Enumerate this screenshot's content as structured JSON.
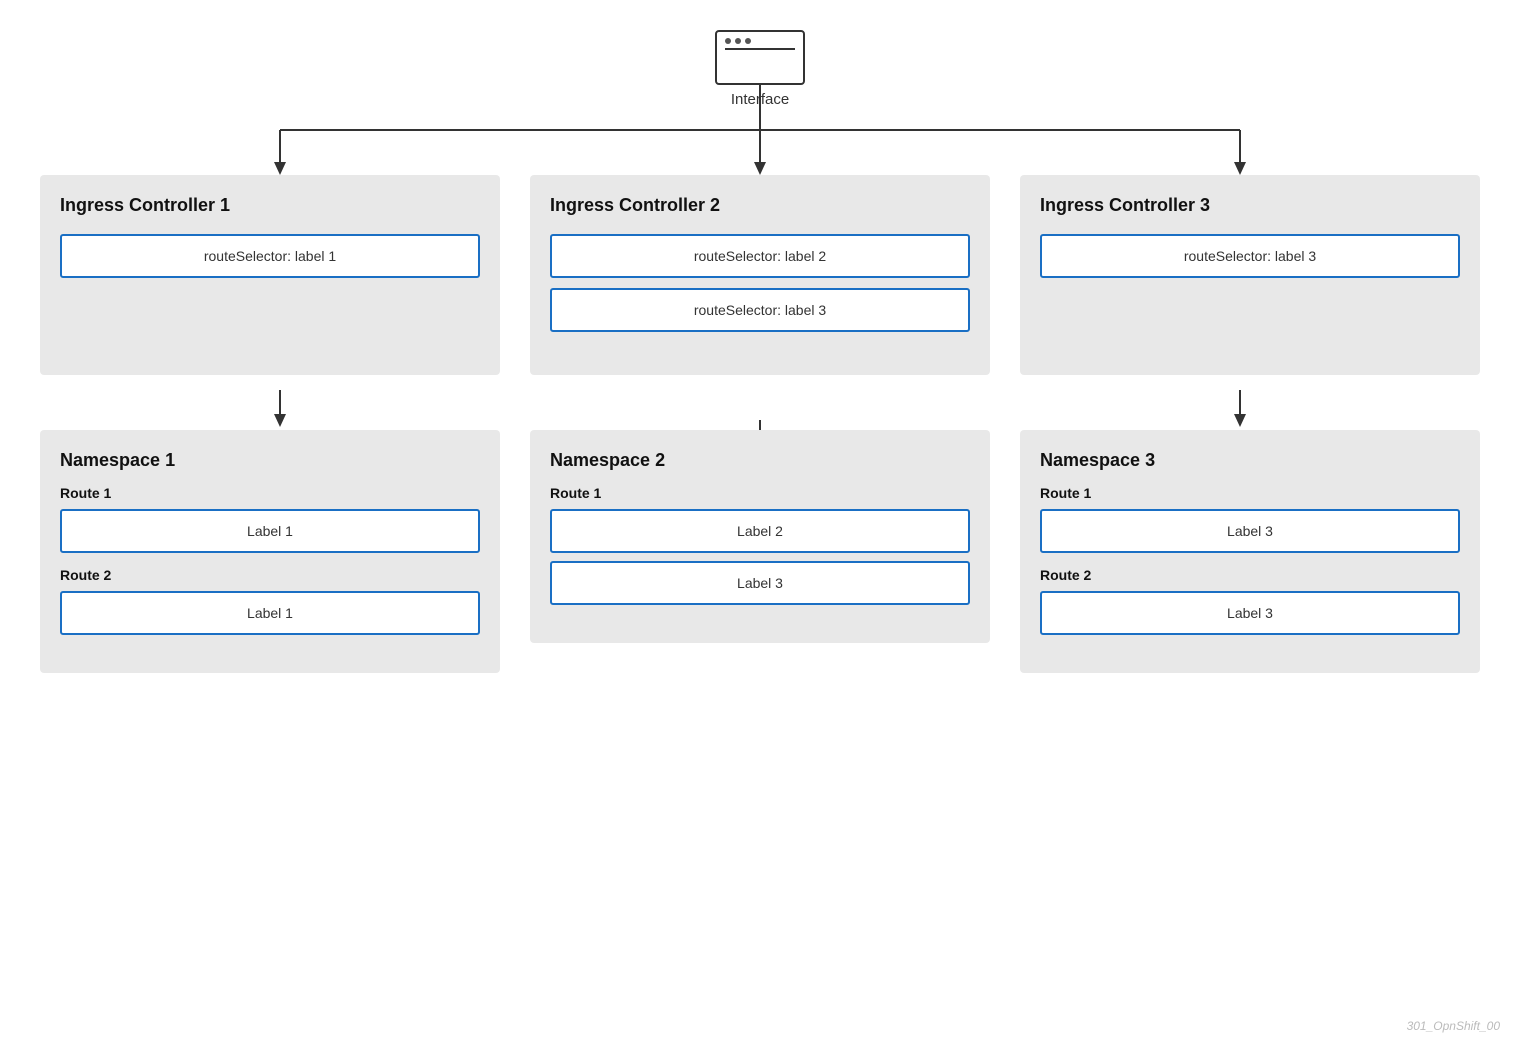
{
  "interface": {
    "label": "Interface"
  },
  "columns": [
    {
      "id": "col1",
      "ingress": {
        "title": "Ingress Controller 1",
        "selectors": [
          "routeSelector: label 1"
        ]
      },
      "namespace": {
        "title": "Namespace 1",
        "routes": [
          {
            "label": "Route 1",
            "labels": [
              "Label 1"
            ]
          },
          {
            "label": "Route 2",
            "labels": [
              "Label 1"
            ]
          }
        ]
      }
    },
    {
      "id": "col2",
      "ingress": {
        "title": "Ingress Controller 2",
        "selectors": [
          "routeSelector: label 2",
          "routeSelector: label 3"
        ]
      },
      "namespace": {
        "title": "Namespace 2",
        "routes": [
          {
            "label": "Route 1",
            "labels": [
              "Label 2",
              "Label 3"
            ]
          }
        ]
      }
    },
    {
      "id": "col3",
      "ingress": {
        "title": "Ingress Controller 3",
        "selectors": [
          "routeSelector: label 3"
        ]
      },
      "namespace": {
        "title": "Namespace 3",
        "routes": [
          {
            "label": "Route 1",
            "labels": [
              "Label 3"
            ]
          },
          {
            "label": "Route 2",
            "labels": [
              "Label 3"
            ]
          }
        ]
      }
    }
  ],
  "watermark": "301_OpnShift_00"
}
